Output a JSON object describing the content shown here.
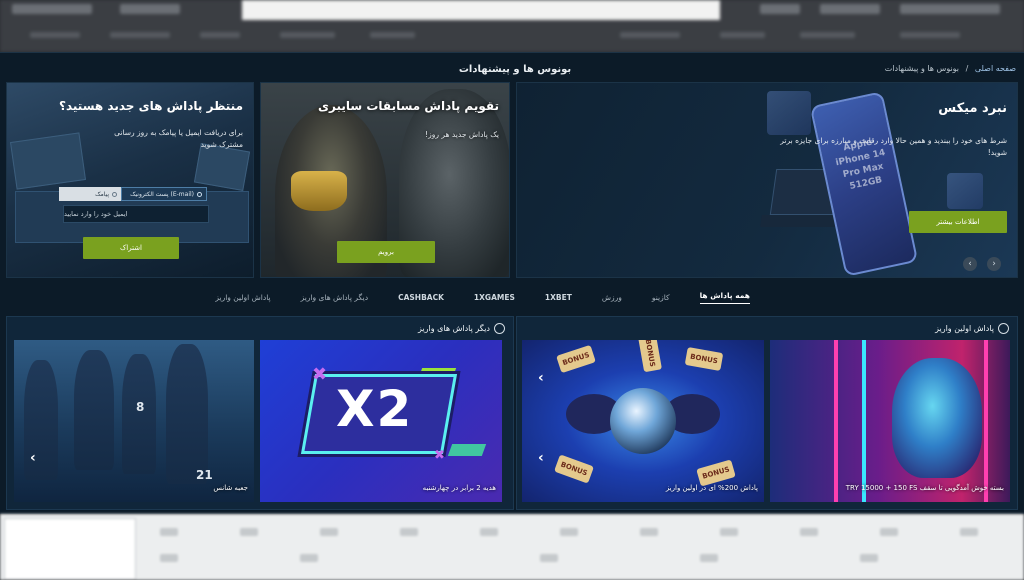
{
  "header": {
    "title": "بونوس ها و پیشنهادات",
    "breadcrumb": {
      "home": "صفحه اصلی",
      "separator": "/",
      "current": "بونوس ها و پیشنهادات"
    }
  },
  "banners": {
    "newsletter": {
      "title": "منتظر پاداش های جدید هستید؟",
      "description": "برای دریافت ایمیل یا پیامک به روز رسانی مشترک شوید",
      "option_email": "پست الکترونیک (E-mail)",
      "option_sms": "پیامک",
      "input_placeholder": "ایمیل خود را وارد نمایید",
      "button_label": "اشتراک"
    },
    "cybersport": {
      "title": "تقویم پاداش مسابقات سایبری",
      "description": "یک پاداش جدید هر روز!",
      "button_label": "برویم"
    },
    "battle": {
      "title": "نبرد میکس",
      "description": "شرط های خود را ببندید و همین حالا وارد رقابت و مبارزه برای جایزه برتر شوید!",
      "button_label": "اطلاعات بیشتر",
      "phone_text": "Apple iPhone 14 Pro Max 512GB"
    }
  },
  "tabs": [
    {
      "label": "همه پاداش ها",
      "active": true,
      "latin": false
    },
    {
      "label": "کازینو",
      "active": false,
      "latin": false
    },
    {
      "label": "ورزش",
      "active": false,
      "latin": false
    },
    {
      "label": "1XBET",
      "active": false,
      "latin": true
    },
    {
      "label": "1XGAMES",
      "active": false,
      "latin": true
    },
    {
      "label": "CASHBACK",
      "active": false,
      "latin": true
    },
    {
      "label": "دیگر پاداش های واریز",
      "active": false,
      "latin": false
    },
    {
      "label": "پاداش اولین واریز",
      "active": false,
      "latin": false
    }
  ],
  "sections": {
    "first_deposit": {
      "title": "پاداش اولین واریز",
      "cards": [
        {
          "caption": "بسته خوش آمدگویی تا سقف TRY 15000 + 150 FS"
        },
        {
          "caption": "پاداش 200% ای در اولین واریز"
        }
      ]
    },
    "other_deposit": {
      "title": "دیگر پاداش های واریز",
      "cards": [
        {
          "caption": "هدیه 2 برابر در چهارشنبه",
          "art_text": "X2"
        },
        {
          "caption": "جعبه شانس"
        }
      ]
    }
  },
  "colors": {
    "accent_green": "#7aa11f",
    "panel_bg": "#0c1b28",
    "section_bg": "#10263a"
  }
}
